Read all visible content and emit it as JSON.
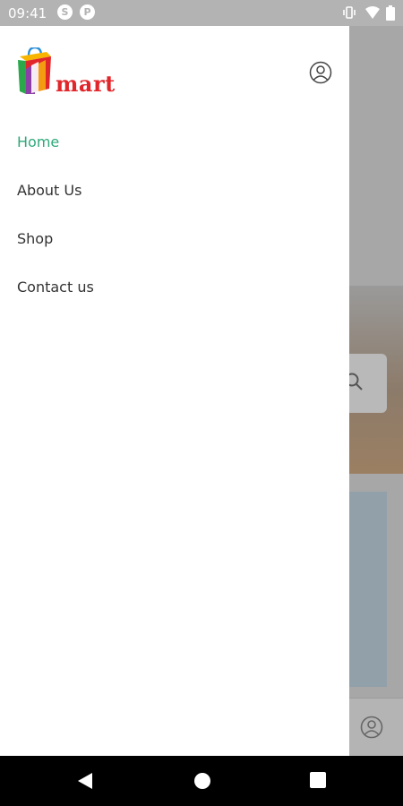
{
  "status_bar": {
    "time": "09:41",
    "notification_icons": [
      "skype-icon",
      "p-badge-icon"
    ],
    "right_icons": [
      "vibrate-icon",
      "wifi-icon",
      "battery-icon"
    ]
  },
  "drawer": {
    "logo_text": "mart",
    "profile_icon": "user-circle-icon",
    "menu": [
      {
        "label": "Home",
        "active": true
      },
      {
        "label": "About Us",
        "active": false
      },
      {
        "label": "Shop",
        "active": false
      },
      {
        "label": "Contact us",
        "active": false
      }
    ]
  },
  "navigation_bar": {
    "buttons": [
      "back-icon",
      "home-icon",
      "recents-icon"
    ]
  },
  "colors": {
    "accent": "#2fa97a",
    "brand_red": "#e1262b",
    "status_bar": "#b3b3b3",
    "text": "#333333"
  }
}
